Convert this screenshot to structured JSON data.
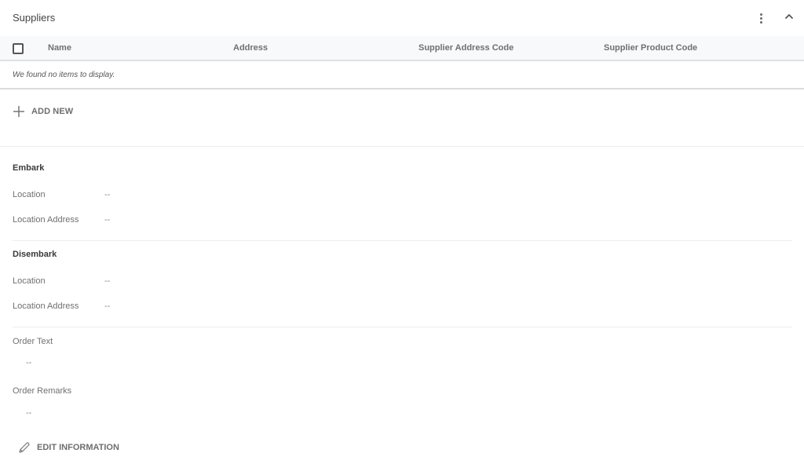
{
  "suppliers": {
    "title": "Suppliers",
    "icons": {
      "more": "more-vert-icon",
      "collapse": "chevron-up-icon"
    },
    "table": {
      "columns": [
        "Name",
        "Address",
        "Supplier Address Code",
        "Supplier Product Code"
      ],
      "empty_message": "We found no items to display.",
      "select_all_checked": false
    },
    "add_new_label": "ADD NEW"
  },
  "embark": {
    "title": "Embark",
    "fields": [
      {
        "label": "Location",
        "value": "--"
      },
      {
        "label": "Location Address",
        "value": "--"
      }
    ]
  },
  "disembark": {
    "title": "Disembark",
    "fields": [
      {
        "label": "Location",
        "value": "--"
      },
      {
        "label": "Location Address",
        "value": "--"
      }
    ]
  },
  "order_text": {
    "label": "Order Text",
    "value": "--"
  },
  "order_remarks": {
    "label": "Order Remarks",
    "value": "--"
  },
  "edit_information_label": "EDIT INFORMATION",
  "colors": {
    "header_bg": "#f8f9fa",
    "text_primary": "#3c3c3c",
    "text_muted": "#707070",
    "divider": "#eeeeee"
  }
}
